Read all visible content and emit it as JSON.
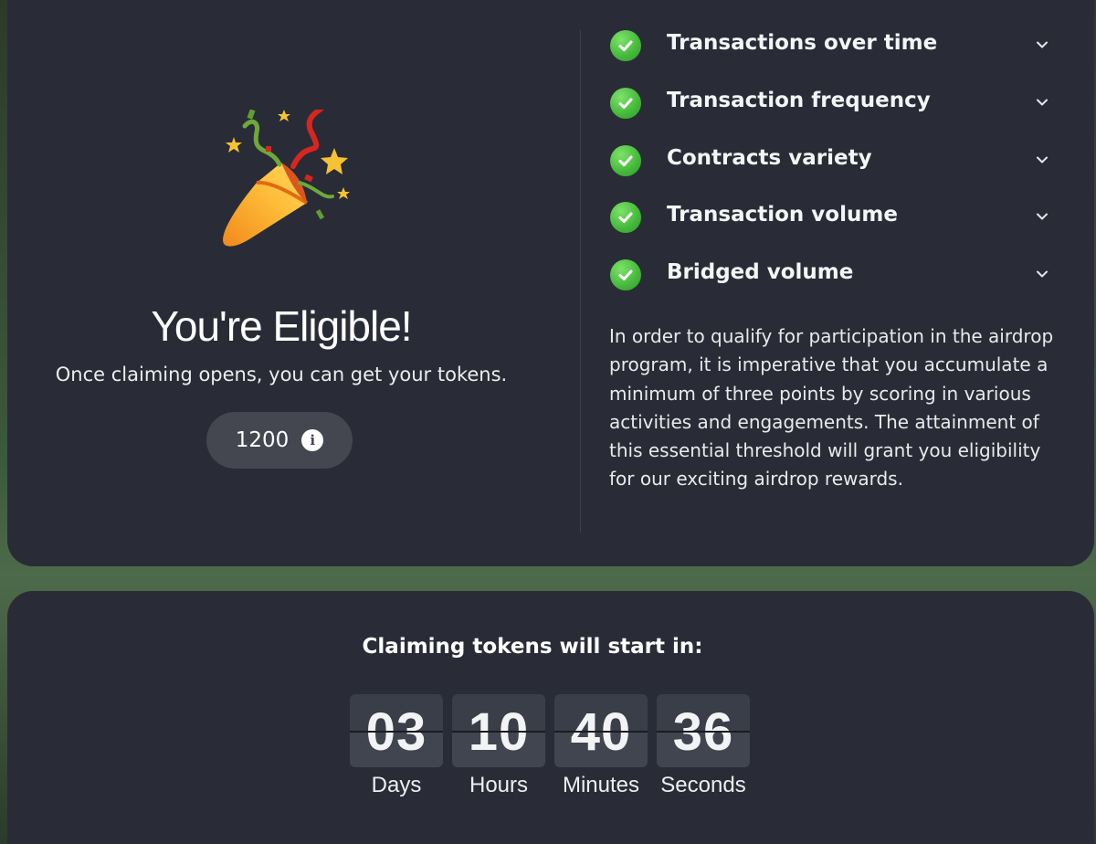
{
  "eligibility": {
    "title": "You're Eligible!",
    "subtitle": "Once claiming opens, you can get your tokens.",
    "points": "1200",
    "icon": "party-popper-icon"
  },
  "criteria": [
    {
      "label": "Transactions over time",
      "status": "passed"
    },
    {
      "label": "Transaction frequency",
      "status": "passed"
    },
    {
      "label": "Contracts variety",
      "status": "passed"
    },
    {
      "label": "Transaction volume",
      "status": "passed"
    },
    {
      "label": "Bridged volume",
      "status": "passed"
    }
  ],
  "description": "In order to qualify for participation in the airdrop program, it is imperative that you accumulate a minimum of three points by scoring in various activities and engagements. The attainment of this essential threshold will grant you eligibility for our exciting airdrop rewards.",
  "countdown": {
    "heading": "Claiming tokens will start in:",
    "units": [
      {
        "value": "03",
        "label": "Days"
      },
      {
        "value": "10",
        "label": "Hours"
      },
      {
        "value": "40",
        "label": "Minutes"
      },
      {
        "value": "36",
        "label": "Seconds"
      }
    ]
  },
  "colors": {
    "card": "#292c36",
    "check": "#44b83a",
    "pill": "#444750",
    "flip_card": "#3a3e49"
  }
}
